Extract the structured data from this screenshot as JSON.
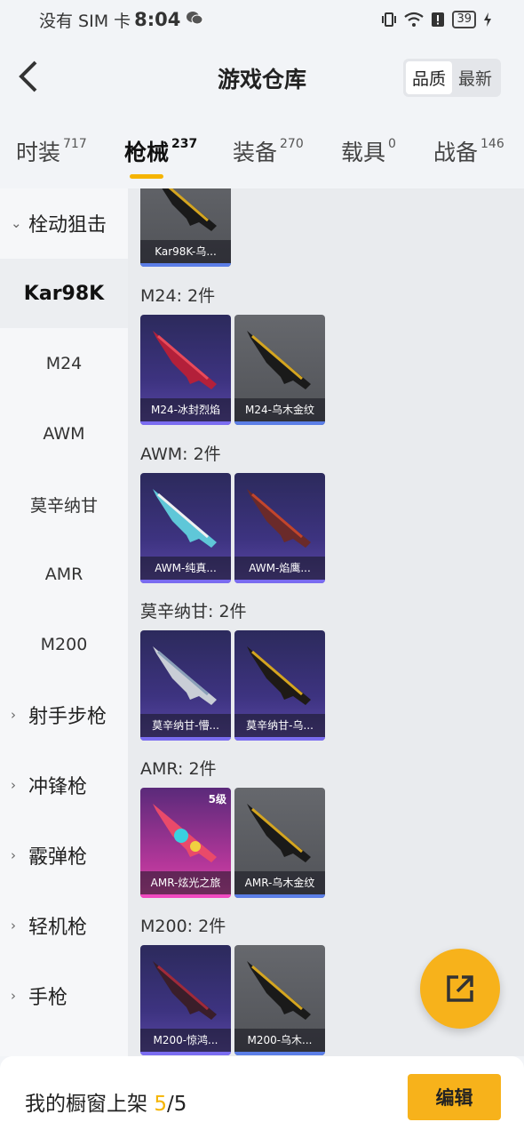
{
  "status_bar": {
    "carrier": "没有 SIM 卡",
    "time": "8:04",
    "battery": "39"
  },
  "header": {
    "title": "游戏仓库",
    "sort_options": [
      "品质",
      "最新"
    ]
  },
  "tabs": [
    {
      "label": "时装",
      "count": "717"
    },
    {
      "label": "枪械",
      "count": "237"
    },
    {
      "label": "装备",
      "count": "270"
    },
    {
      "label": "载具",
      "count": "0"
    },
    {
      "label": "战备",
      "count": "146"
    }
  ],
  "sidebar": {
    "group_open": "栓动狙击",
    "items": [
      "Kar98K",
      "M24",
      "AWM",
      "莫辛纳甘",
      "AMR",
      "M200"
    ],
    "groups": [
      "射手步枪",
      "冲锋枪",
      "霰弹枪",
      "轻机枪",
      "手枪"
    ]
  },
  "sections": [
    {
      "label": "",
      "cards": [
        {
          "name": "Kar98K-乌...",
          "style": "gray"
        }
      ]
    },
    {
      "label": "M24: 2件",
      "cards": [
        {
          "name": "M24-冰封烈焰",
          "style": "purple"
        },
        {
          "name": "M24-乌木金纹",
          "style": "gray"
        }
      ]
    },
    {
      "label": "AWM: 2件",
      "cards": [
        {
          "name": "AWM-纯真...",
          "style": "purple"
        },
        {
          "name": "AWM-焰鹰...",
          "style": "purple"
        }
      ]
    },
    {
      "label": "莫辛纳甘: 2件",
      "cards": [
        {
          "name": "莫辛纳甘-懵...",
          "style": "purple"
        },
        {
          "name": "莫辛纳甘-乌...",
          "style": "purple"
        }
      ]
    },
    {
      "label": "AMR: 2件",
      "cards": [
        {
          "name": "AMR-炫光之旅",
          "style": "pink",
          "level": "5级"
        },
        {
          "name": "AMR-乌木金纹",
          "style": "gray"
        }
      ]
    },
    {
      "label": "M200: 2件",
      "cards": [
        {
          "name": "M200-惊鸿...",
          "style": "purple"
        },
        {
          "name": "M200-乌木...",
          "style": "gray"
        }
      ]
    }
  ],
  "footer": {
    "label": "我的橱窗上架",
    "current": "5",
    "total": "/5",
    "edit_label": "编辑"
  },
  "colors": {
    "accent": "#f7b21b",
    "card_gray": "#5a5c61",
    "card_purple": "#3d3380",
    "card_pink": "#de4aa8"
  },
  "icons": {
    "back": "chevron-left-icon",
    "share": "external-link-icon",
    "wechat": "wechat-icon",
    "wifi": "wifi-icon"
  }
}
